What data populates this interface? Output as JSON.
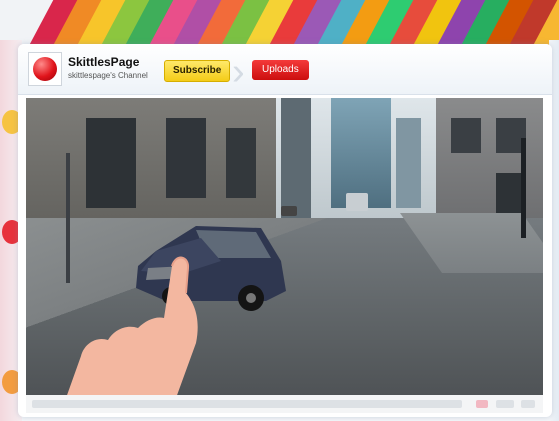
{
  "header": {
    "channel_name": "SkittlesPage",
    "channel_subtitle": "skittlespage's Channel",
    "subscribe_label": "Subscribe",
    "uploads_label": "Uploads"
  },
  "icons": {
    "avatar": "red-ball-logo-icon"
  },
  "colors": {
    "subscribe_bg": "#f4cc18",
    "uploads_bg": "#cc0e0e",
    "avatar_ball": "#e0141b"
  },
  "stripes": [
    "#d9264b",
    "#f08a25",
    "#f7c52a",
    "#8cc63f",
    "#3fae5a",
    "#e94f8a",
    "#b04fa6",
    "#f26b3a",
    "#7bc143",
    "#f5d234",
    "#e93b3b",
    "#9b59b6",
    "#4fb0c6",
    "#f39c12",
    "#2ecc71",
    "#e74c3c",
    "#f1c40f",
    "#8e44ad",
    "#27ae60",
    "#d35400",
    "#c0392b",
    "#f7b731"
  ]
}
